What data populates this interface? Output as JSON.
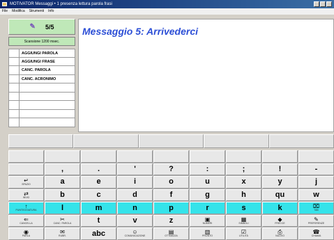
{
  "window": {
    "title": "MOTIVATOR Messaggi • 1 presenza lettura parola frasi",
    "menu": [
      "File",
      "Modifica",
      "Strumenti",
      "Info"
    ]
  },
  "left_panel": {
    "counter": "5/5",
    "scan_label": "Scansione 1200 msec.",
    "commands": [
      "AGGIUNGI PAROLA",
      "AGGIUNGI FRASE",
      "CANC. PAROLA",
      "CANC. ACRONIMO",
      "",
      "",
      "",
      "",
      ""
    ]
  },
  "message": {
    "text": "Messaggio 5:  Arrivederci"
  },
  "prediction_cells": [
    "",
    "",
    "",
    "",
    ""
  ],
  "keyboard": {
    "rows": [
      [
        {
          "ch": ""
        },
        {
          "ch": ","
        },
        {
          "ch": "."
        },
        {
          "ch": "'"
        },
        {
          "ch": "?"
        },
        {
          "ch": ":"
        },
        {
          "ch": ";"
        },
        {
          "ch": "!"
        },
        {
          "ch": "-"
        }
      ],
      [
        {
          "icon": "↵",
          "cap": "Spazio"
        },
        {
          "ch": "a"
        },
        {
          "ch": "e"
        },
        {
          "ch": "i"
        },
        {
          "ch": "o"
        },
        {
          "ch": "u"
        },
        {
          "ch": "x"
        },
        {
          "ch": "y"
        },
        {
          "ch": "j"
        }
      ],
      [
        {
          "icon": "⇄",
          "cap": "Invio"
        },
        {
          "ch": "b"
        },
        {
          "ch": "c"
        },
        {
          "ch": "d"
        },
        {
          "ch": "f"
        },
        {
          "ch": "g"
        },
        {
          "ch": "h"
        },
        {
          "ch": "qu"
        },
        {
          "ch": "w"
        }
      ],
      [
        {
          "icon": "↑",
          "cap": "Punteggiatura"
        },
        {
          "ch": "l"
        },
        {
          "ch": "m"
        },
        {
          "ch": "n"
        },
        {
          "ch": "p"
        },
        {
          "ch": "r"
        },
        {
          "ch": "s"
        },
        {
          "ch": "k"
        },
        {
          "icon": "⌧",
          "cap": "Tab"
        }
      ],
      [
        {
          "icon": "⇐",
          "cap": "Cancella"
        },
        {
          "icon": "✂",
          "cap": "Canc. parola"
        },
        {
          "ch": "t"
        },
        {
          "ch": "v"
        },
        {
          "ch": "z"
        },
        {
          "icon": "▣",
          "cap": "Numeri"
        },
        {
          "icon": "▦",
          "cap": "Simboli"
        },
        {
          "icon": "◆",
          "cap": "Frecce"
        },
        {
          "icon": "✎",
          "cap": "Preferenze"
        }
      ],
      [
        {
          "icon": "◉",
          "cap": "Parla"
        },
        {
          "icon": "✉",
          "cap": "Rubr."
        },
        {
          "ch": "abc"
        },
        {
          "icon": "☺",
          "cap": "Comunicazione"
        },
        {
          "icon": "▤",
          "cap": "Ottimizza"
        },
        {
          "icon": "▥",
          "cap": "Pronto"
        },
        {
          "icon": "☑",
          "cap": "Utilità"
        },
        {
          "icon": "⎙",
          "cap": "Nuovo"
        },
        {
          "icon": "☎",
          "cap": "Chiama"
        }
      ]
    ],
    "highlighted_row": 3
  },
  "colors": {
    "message_text": "#2d4fd6",
    "panel_green": "#bfe8b8",
    "scan_highlight": "#35e3ea"
  }
}
